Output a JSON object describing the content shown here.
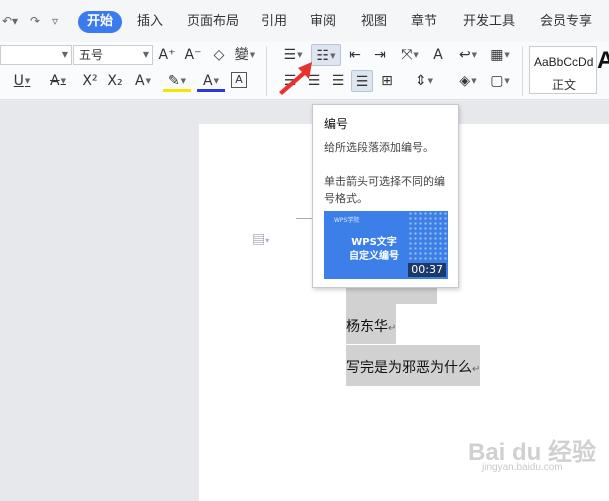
{
  "quick_access": {
    "redo": "↷",
    "menu": "▿"
  },
  "tabs": [
    {
      "label": "开始",
      "active": true
    },
    {
      "label": "插入"
    },
    {
      "label": "页面布局"
    },
    {
      "label": "引用"
    },
    {
      "label": "审阅"
    },
    {
      "label": "视图"
    },
    {
      "label": "章节"
    },
    {
      "label": "开发工具"
    },
    {
      "label": "会员专享"
    }
  ],
  "ribbon": {
    "font_size": "五号",
    "grow": "A⁺",
    "shrink": "A⁻",
    "clear": "◇",
    "phonetic": "變",
    "underline": "U",
    "strike": "A",
    "superscript": "X²",
    "subscript": "X₂",
    "text_effect": "A",
    "highlight": "✎",
    "font_color": "A",
    "char_border": "A",
    "bullets": "☰",
    "numbering": "☷",
    "outdent": "⇤",
    "indent": "⇥",
    "sort": "⤧",
    "show_marks": "A",
    "para_marks": "↩",
    "align_left": "☰",
    "align_center": "☰",
    "align_right": "☰",
    "justify": "☰",
    "distribute": "⊞",
    "line_spacing": "⇕",
    "shading": "◈",
    "borders": "▢",
    "style_sample": "AaBbCcDd",
    "style_name": "正文",
    "big_style": "A"
  },
  "tooltip": {
    "title": "编号",
    "desc": "给所选段落添加编号。",
    "hint": "单击箭头可选择不同的编号格式。",
    "thumb_logo": "WPS学院",
    "thumb_line1": "WPS文字",
    "thumb_line2": "自定义编号",
    "duration": "00:37"
  },
  "document": {
    "line1": "杨东华",
    "line2": "写完是为邪恶为什么",
    "para_mark": "↵"
  },
  "watermark": {
    "logo": "Bai du 经验",
    "url": "jingyan.baidu.com"
  },
  "colors": {
    "accent": "#3b7bf0",
    "arrow": "#e8322e",
    "selection": "#d1d1d1"
  }
}
